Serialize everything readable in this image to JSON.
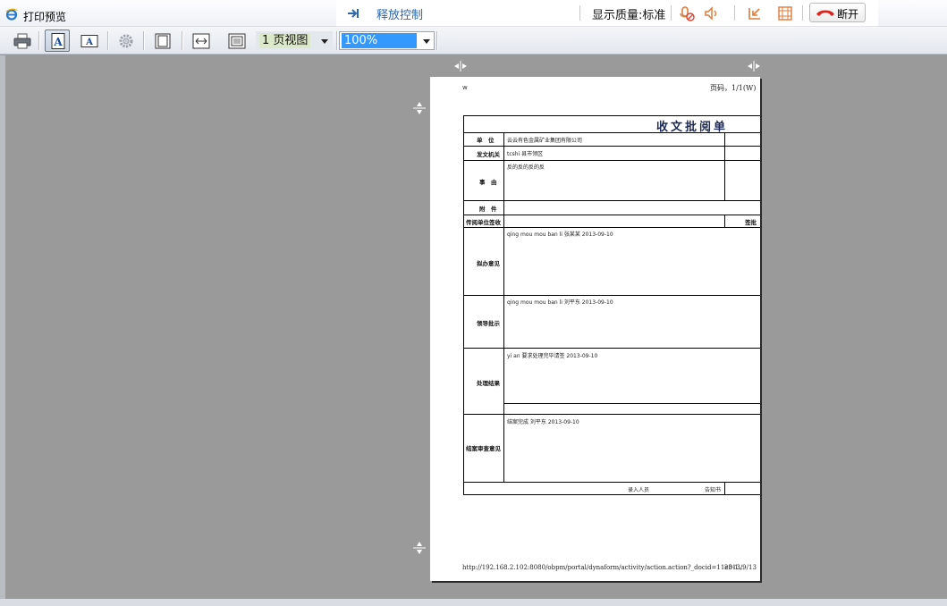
{
  "window": {
    "title": "打印预览"
  },
  "remote_bar": {
    "release_label": "释放控制",
    "quality_label": "显示质量:标准",
    "disconnect_label": "断开",
    "accent_color": "#2b67b0"
  },
  "toolbar": {
    "buttons": [
      "print-icon",
      "page-setup-portrait-icon",
      "page-setup-text-icon",
      "settings-gear-icon",
      "single-page-icon",
      "fit-width-icon",
      "fit-page-icon"
    ],
    "view_mode": "1 页视图",
    "zoom": "100%"
  },
  "page": {
    "header_left": "w",
    "header_right": "页码，1/1(W)",
    "footer_url": "http://192.168.2.102:8080/obpm/portal/dynaform/activity/action.action?_docid=11e3-1...",
    "footer_date": "2013/9/13",
    "form": {
      "title": "收文批阅单",
      "rows": {
        "unit_label": "单　位",
        "unit_value": "云云有色金属矿业集团有限公司",
        "issuer_label": "发文机关",
        "issuer_value": "tcshi 县市领区",
        "reason_label": "事　由",
        "reason_value": "反的反的反的反",
        "attachment_label": "附　件",
        "circulation_label": "传阅单位签收",
        "circulation_right": "签批",
        "opinion_label": "拟办意见",
        "opinion_value": "qing mou mou ban li 张某某 2013-09-10",
        "leader_label": "领导批示",
        "leader_value": "qing mou mou ban li 刘平东 2013-09-10",
        "handling_label": "处理结果",
        "handling_value": "yi an 要求处理完毕请签 2013-09-10",
        "final_label": "结案审查意见",
        "final_value": "结案完成 刘平东 2013-09-10",
        "entry_label": "录入人员",
        "entry_right": "告知书"
      }
    }
  }
}
